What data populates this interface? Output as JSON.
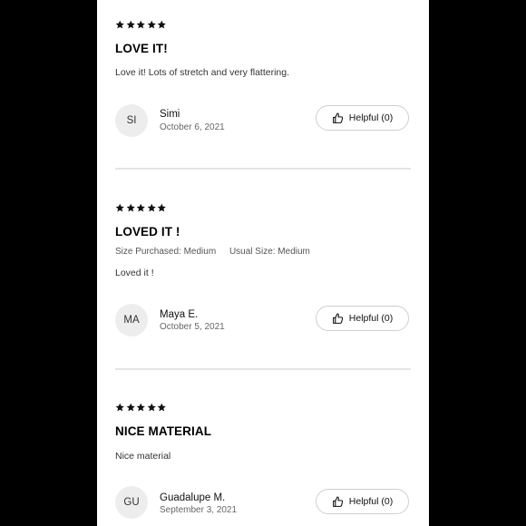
{
  "reviews": [
    {
      "rating": 5,
      "title": "LOVE IT!",
      "size_purchased": "",
      "usual_size": "",
      "body": "Love it! Lots of stretch and very flattering.",
      "initials": "SI",
      "author": "Simi",
      "date": "October 6, 2021",
      "helpful_label": "Helpful (0)"
    },
    {
      "rating": 5,
      "title": "LOVED IT !",
      "size_purchased": "Size Purchased: Medium",
      "usual_size": "Usual Size: Medium",
      "body": "Loved it !",
      "initials": "MA",
      "author": "Maya E.",
      "date": "October 5, 2021",
      "helpful_label": "Helpful (0)"
    },
    {
      "rating": 5,
      "title": "NICE MATERIAL",
      "size_purchased": "",
      "usual_size": "",
      "body": "Nice material",
      "initials": "GU",
      "author": "Guadalupe M.",
      "date": "September 3, 2021",
      "helpful_label": "Helpful (0)"
    }
  ],
  "icons": {
    "star": "star-icon",
    "helpful": "thumbs-up-icon"
  },
  "colors": {
    "background": "#000000",
    "panel": "#ffffff",
    "avatar": "#ededed",
    "divider": "#e5e5e5"
  }
}
